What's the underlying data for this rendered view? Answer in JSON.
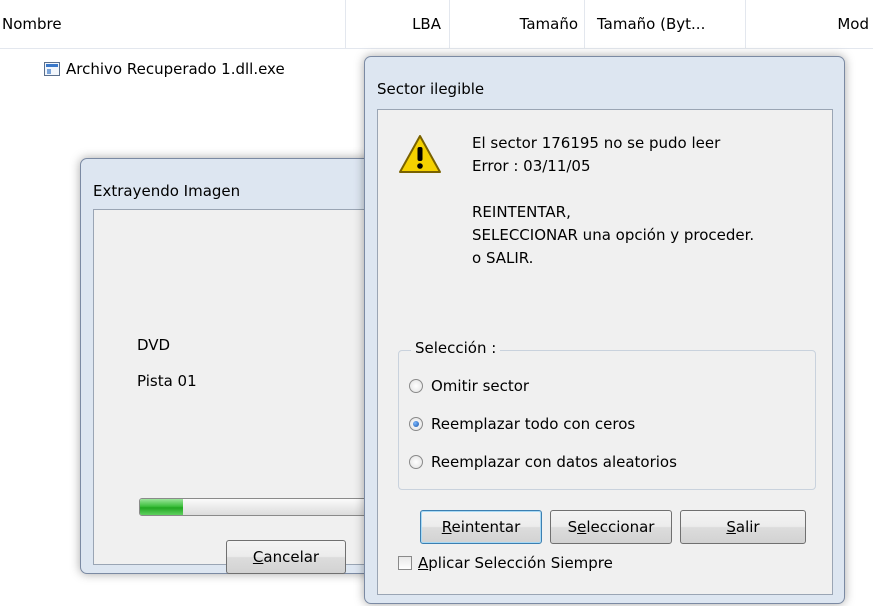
{
  "list": {
    "columns": [
      "Nombre",
      "LBA",
      "Tamaño",
      "Tamaño (Byt...",
      "Mod"
    ],
    "file_name": "Archivo Recuperado 1.dll.exe"
  },
  "extract_window": {
    "title": "Extrayendo Imagen",
    "media": "DVD",
    "track": "Pista 01",
    "progress_fraction": 0.18,
    "cancel": {
      "access_key": "C",
      "rest": "ancelar"
    }
  },
  "sector_dialog": {
    "title": "Sector ilegible",
    "message_lines": [
      "El sector 176195 no se pudo leer",
      "Error : 03/11/05",
      "",
      "REINTENTAR,",
      "SELECCIONAR una opción y proceder.",
      "o SALIR."
    ],
    "group_label": "Selección :",
    "options": [
      {
        "label": "Omitir sector",
        "checked": false
      },
      {
        "label": "Reemplazar todo con ceros",
        "checked": true
      },
      {
        "label": "Reemplazar con datos aleatorios",
        "checked": false
      }
    ],
    "buttons": {
      "retry": {
        "access_key": "R",
        "rest": "eintentar"
      },
      "select": {
        "pre": "S",
        "access_key": "e",
        "rest": "leccionar"
      },
      "exit": {
        "access_key": "S",
        "rest": "alir"
      }
    },
    "always_apply": {
      "access_key": "A",
      "rest": "plicar Selección Siempre",
      "checked": false
    }
  },
  "colors": {
    "window_frame": "#dde6f1",
    "client_bg": "#f0f0f0",
    "progress_green": "#3fc03f",
    "warning_yellow": "#f5d100",
    "focus_blue": "#3c7fb1"
  },
  "icons": [
    "exe-file-icon",
    "warning-icon"
  ]
}
